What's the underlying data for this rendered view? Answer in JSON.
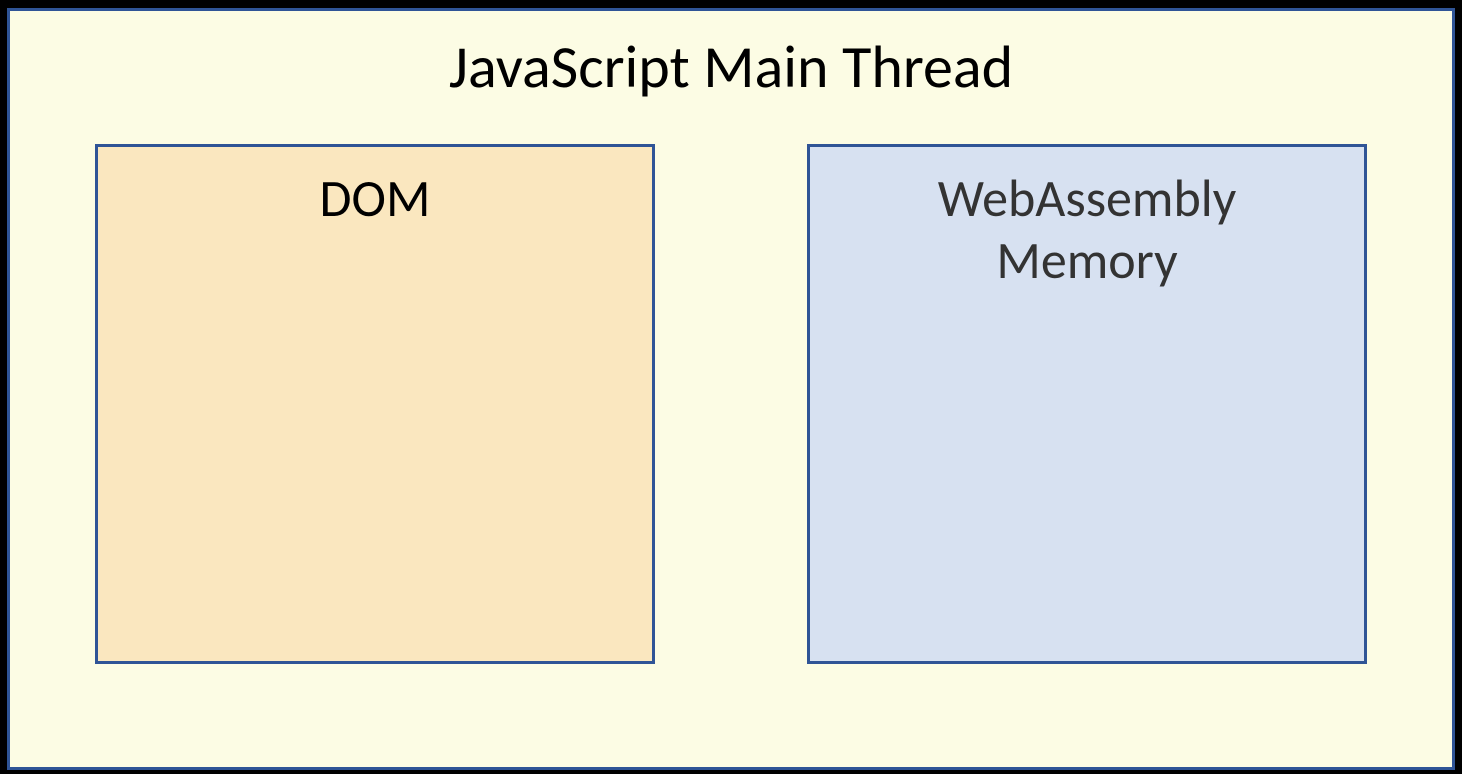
{
  "title": "JavaScript Main Thread",
  "boxes": {
    "dom": {
      "label": "DOM"
    },
    "wasm": {
      "label_line1": "WebAssembly",
      "label_line2": "Memory"
    }
  },
  "colors": {
    "outer_bg": "#fcfce4",
    "border": "#2f5496",
    "dom_bg": "#fae7bf",
    "wasm_bg": "#d7e1f1"
  }
}
